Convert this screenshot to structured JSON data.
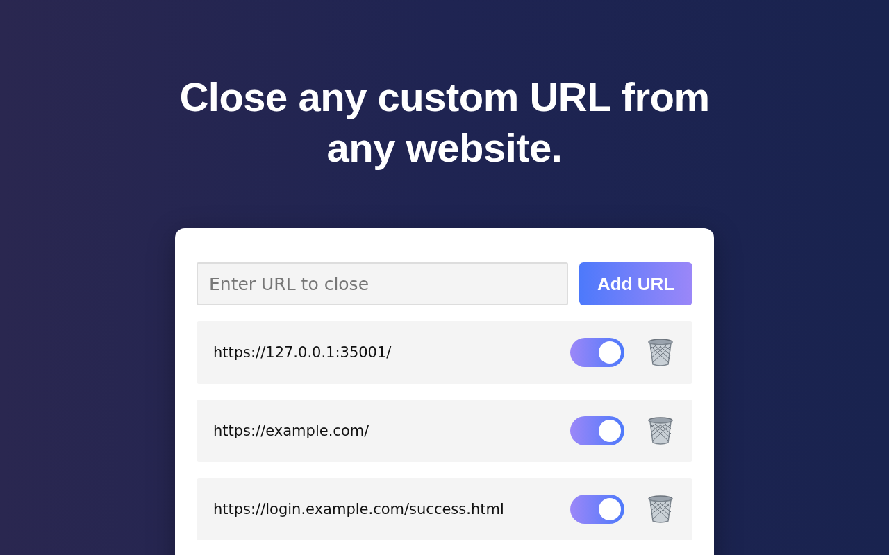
{
  "headline": "Close any custom URL from any website.",
  "input": {
    "placeholder": "Enter URL to close"
  },
  "add_button": "Add URL",
  "urls": [
    {
      "url": "https://127.0.0.1:35001/",
      "on": true
    },
    {
      "url": "https://example.com/",
      "on": true
    },
    {
      "url": "https://login.example.com/success.html",
      "on": true
    }
  ]
}
